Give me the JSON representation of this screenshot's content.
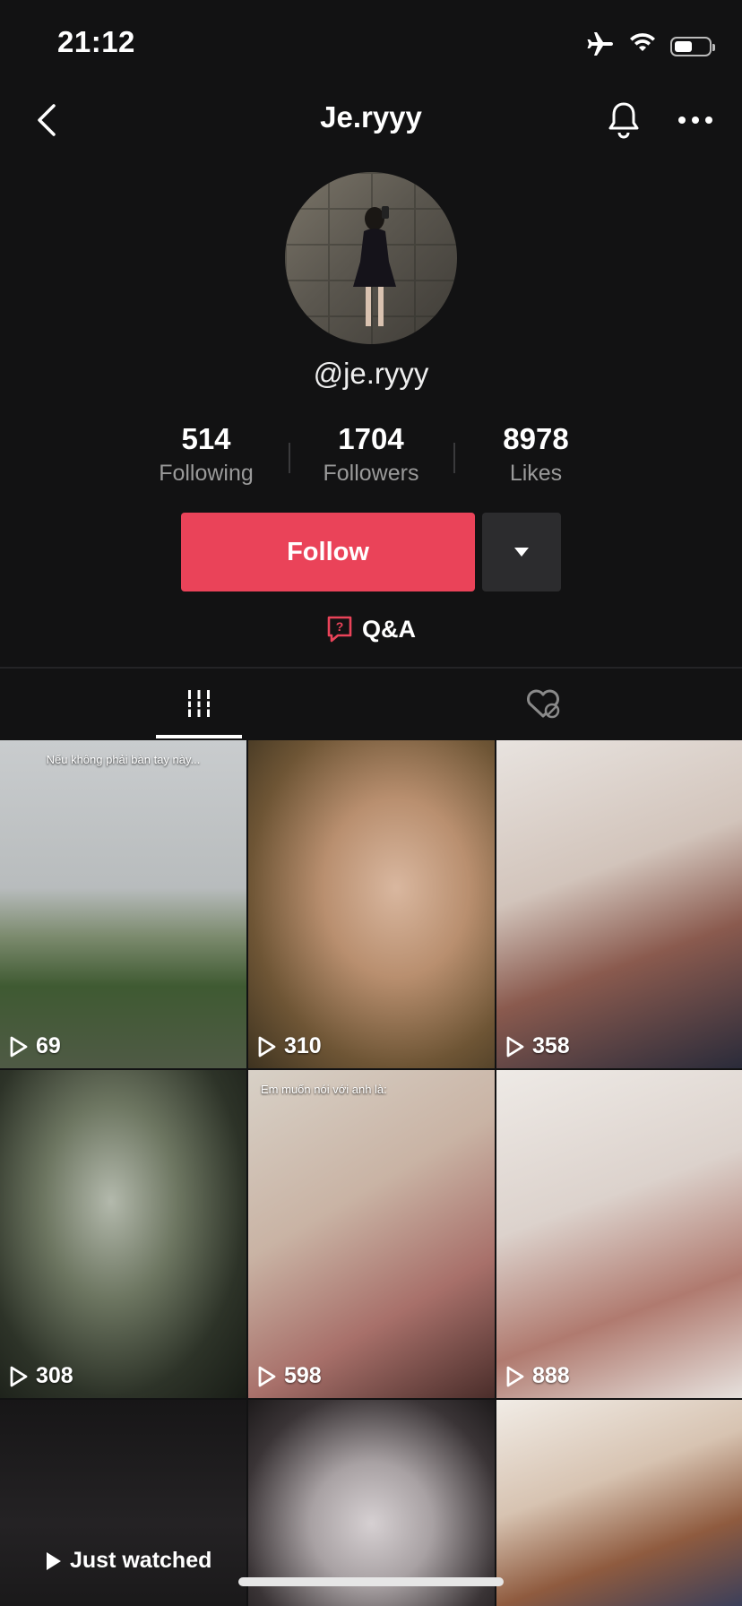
{
  "status_bar": {
    "time": "21:12"
  },
  "nav": {
    "title": "Je.ryyy"
  },
  "profile": {
    "handle": "@je.ryyy",
    "stats": [
      {
        "value": "514",
        "label": "Following"
      },
      {
        "value": "1704",
        "label": "Followers"
      },
      {
        "value": "8978",
        "label": "Likes"
      }
    ],
    "follow_label": "Follow",
    "qa_label": "Q&A"
  },
  "tabs": {
    "active": "videos"
  },
  "videos": [
    {
      "views": "69",
      "caption": "Nếu không phải bàn tay này..."
    },
    {
      "views": "310",
      "caption": ""
    },
    {
      "views": "358",
      "caption": ""
    },
    {
      "views": "308",
      "caption": ""
    },
    {
      "views": "598",
      "caption": "Em muốn nói với anh là:"
    },
    {
      "views": "888",
      "caption": ""
    },
    {
      "views": "",
      "caption": "",
      "badge": "Just watched"
    },
    {
      "views": "",
      "caption": ""
    },
    {
      "views": "",
      "caption": ""
    }
  ],
  "colors": {
    "background": "#121213",
    "follow": "#ea4359",
    "qa_icon": "#ea4359"
  },
  "icons": [
    "airplane-icon",
    "wifi-icon",
    "battery-icon",
    "back-icon",
    "bell-icon",
    "more-icon",
    "chevron-down-icon",
    "qa-icon",
    "grid-icon",
    "liked-hidden-icon",
    "play-icon"
  ]
}
